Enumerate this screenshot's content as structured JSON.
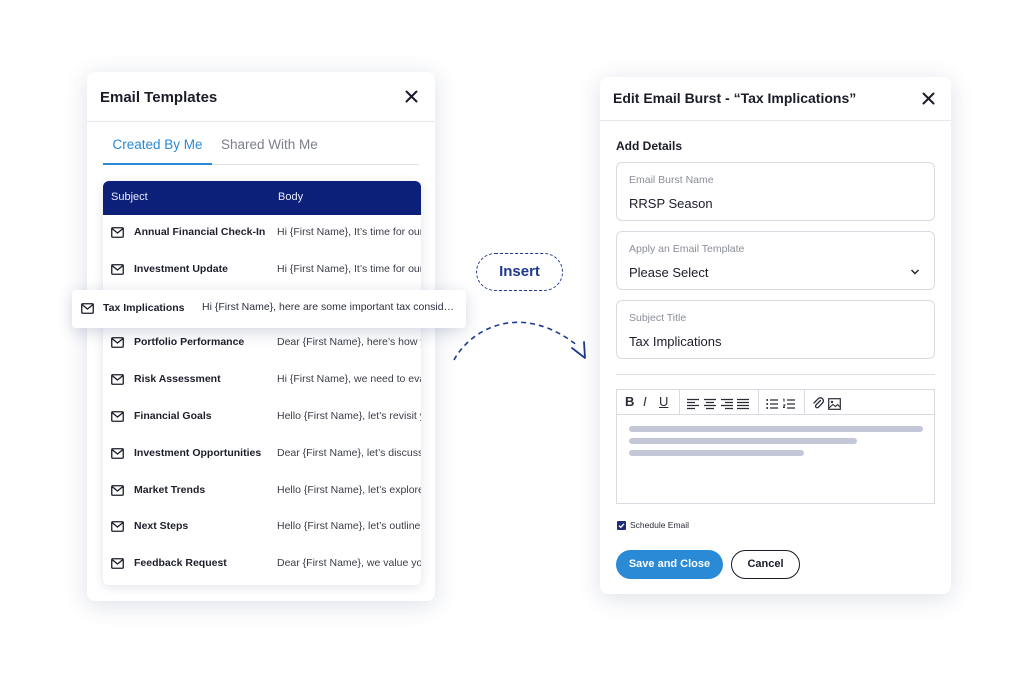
{
  "templates_panel": {
    "title": "Email Templates",
    "tabs": [
      {
        "label": "Created By Me",
        "active": true
      },
      {
        "label": "Shared With Me",
        "active": false
      }
    ],
    "columns": [
      "Subject",
      "Body"
    ],
    "rows": [
      {
        "subject": "Annual Financial Check-In",
        "body": "Hi {First Name}, It’s time for our annual financial check-in"
      },
      {
        "subject": "Investment Update",
        "body": "Hi {First Name}, It’s time for our investment update"
      },
      {
        "subject": "Portfolio Performance",
        "body": "Dear {First Name}, here’s how your portfolio performed"
      },
      {
        "subject": "Risk Assessment",
        "body": "Hi {First Name}, we need to evaluate your risk"
      },
      {
        "subject": "Financial Goals",
        "body": "Hello {First Name}, let’s revisit your financial goals"
      },
      {
        "subject": "Investment Opportunities",
        "body": "Dear {First Name}, let’s discuss new opportunities"
      },
      {
        "subject": "Market Trends",
        "body": "Hello {First Name}, let’s explore the market trends"
      },
      {
        "subject": "Next Steps",
        "body": "Hello {First Name}, let’s outline the next steps"
      },
      {
        "subject": "Feedback Request",
        "body": "Dear {First Name}, we value your feedback"
      }
    ],
    "dragged_row": {
      "subject": "Tax Implications",
      "body": "Hi {First Name}, here are some important tax consid…"
    }
  },
  "insert_label": "Insert",
  "edit_panel": {
    "title": "Edit Email Burst - “Tax Implications”",
    "section_title": "Add Details",
    "fields": {
      "burst_name": {
        "label": "Email Burst Name",
        "value": "RRSP Season"
      },
      "template": {
        "label": "Apply an Email Template",
        "value": "Please Select"
      },
      "subject": {
        "label": "Subject Title",
        "value": "Tax Implications"
      }
    },
    "toolbar": {
      "bold": "B",
      "italic": "I",
      "underline": "U"
    },
    "schedule_label": "Schedule Email",
    "schedule_checked": true,
    "save_label": "Save  and Close",
    "cancel_label": "Cancel"
  },
  "colors": {
    "accent_blue": "#2a8ad6",
    "navy": "#0d2079",
    "dashed_arrow": "#1f3a8f"
  },
  "icons": [
    "close-icon",
    "mail-icon",
    "chevron-down-icon",
    "align-left-icon",
    "align-center-icon",
    "align-right-icon",
    "align-justify-icon",
    "bulleted-list-icon",
    "numbered-list-icon",
    "attachment-icon",
    "image-icon",
    "checkbox-checked-icon",
    "dashed-arrow-icon"
  ]
}
